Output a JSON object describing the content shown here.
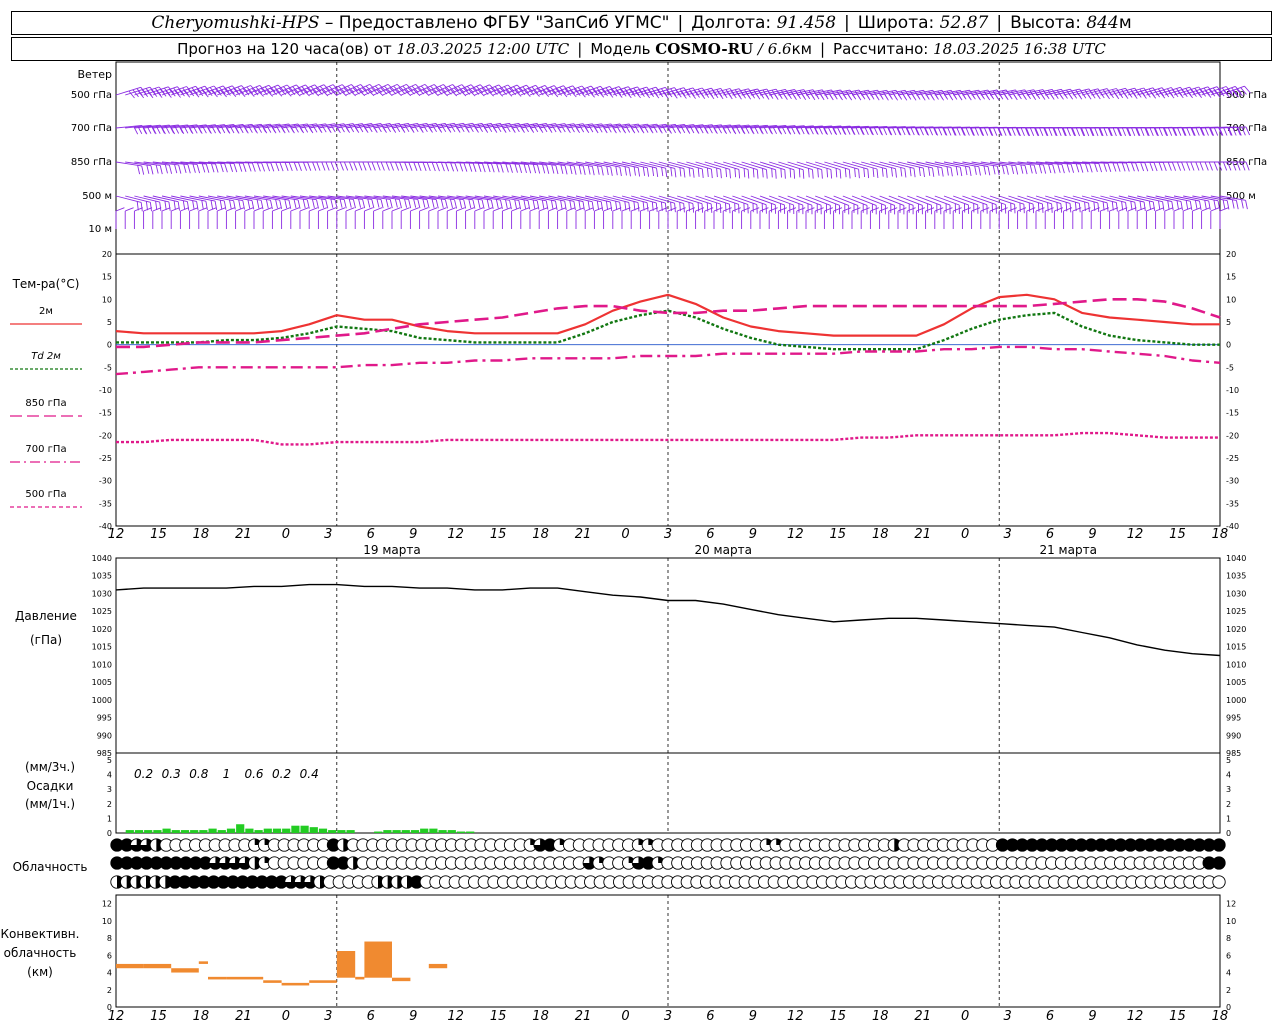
{
  "header": {
    "station": "Cheryomushki-HPS",
    "provider": "– Предоставлено ФГБУ \"ЗапСиб УГМС\"",
    "lon_label": "Долгота:",
    "lon_value": "91.458",
    "lat_label": "Широта:",
    "lat_value": "52.87",
    "alt_label": "Высота:",
    "alt_value": "844",
    "alt_unit": "м",
    "forecast_label": "Прогноз на 120 часа(ов) от",
    "forecast_start": "18.03.2025 12:00 UTC",
    "model_label": "Модель",
    "model_name": "COSMO-RU",
    "model_res": "/ 6.6",
    "model_res_unit": "км",
    "computed_label": "Рассчитано:",
    "computed_time": "18.03.2025 16:38 UTC"
  },
  "time_axis": {
    "ticks": [
      "12",
      "15",
      "18",
      "21",
      "0",
      "3",
      "6",
      "9",
      "12",
      "15",
      "18",
      "21",
      "0",
      "3",
      "6",
      "9",
      "12",
      "15",
      "18",
      "21",
      "0",
      "3",
      "6",
      "9",
      "12",
      "15",
      "18"
    ],
    "date_labels": [
      "19 марта",
      "20 марта",
      "21 марта"
    ]
  },
  "wind": {
    "title": "Ветер",
    "levels": [
      "500 гПа",
      "700 гПа",
      "850 гПа",
      "500 м",
      "10 м"
    ],
    "color": "#8a2be2"
  },
  "colors": {
    "t2m": "#ee3333",
    "td2m": "#117711",
    "t850": "#e0198a",
    "t700": "#e0198a",
    "t500": "#e0198a",
    "pressure": "#000000",
    "precip": "#22cc22",
    "conv": "#f08a30",
    "zero_line": "#2255cc"
  },
  "chart_data": [
    {
      "type": "line",
      "title": "Тем-ра(°C)",
      "ylim": [
        -40,
        20
      ],
      "yticks": [
        20,
        15,
        10,
        5,
        0,
        -5,
        -10,
        -15,
        -20,
        -25,
        -30,
        -35,
        -40
      ],
      "x_hours": [
        0,
        3,
        6,
        9,
        12,
        15,
        18,
        21,
        24,
        27,
        30,
        33,
        36,
        39,
        42,
        45,
        48,
        51,
        54,
        57,
        60,
        63,
        66,
        69,
        72,
        75,
        78,
        81,
        84,
        87,
        90,
        93,
        96,
        99,
        102,
        105,
        108,
        111,
        114,
        117,
        120
      ],
      "series": [
        {
          "name": "2м",
          "values": [
            3,
            2.5,
            2.5,
            2.5,
            2.5,
            2.5,
            3,
            4.5,
            6.5,
            5.5,
            5.5,
            4,
            3,
            2.5,
            2.5,
            2.5,
            2.5,
            4.5,
            7.5,
            9.5,
            11,
            9,
            6,
            4,
            3,
            2.5,
            2,
            2,
            2,
            2,
            4.5,
            8,
            10.5,
            11,
            10,
            7,
            6,
            5.5,
            5,
            4.5,
            4.5
          ]
        },
        {
          "name": "Td 2м",
          "values": [
            0.5,
            0.5,
            0.5,
            0.5,
            1,
            1,
            1.5,
            2.5,
            4,
            3.5,
            3,
            1.5,
            1,
            0.5,
            0.5,
            0.5,
            0.5,
            2.5,
            5,
            6.5,
            7.5,
            6,
            3.5,
            1.5,
            0,
            -0.5,
            -1,
            -1,
            -1,
            -1,
            1,
            3.5,
            5.5,
            6.5,
            7,
            4,
            2,
            1,
            0.5,
            0,
            0
          ]
        },
        {
          "name": "850 гПа",
          "values": [
            -0.5,
            -0.5,
            0,
            0.5,
            0.5,
            0.5,
            1,
            1.5,
            2,
            2.5,
            3.5,
            4.5,
            5,
            5.5,
            6,
            7,
            8,
            8.5,
            8.5,
            7.5,
            7,
            7,
            7.5,
            7.5,
            8,
            8.5,
            8.5,
            8.5,
            8.5,
            8.5,
            8.5,
            8.5,
            8.5,
            8.5,
            9,
            9.5,
            10,
            10,
            9.5,
            8,
            6
          ]
        },
        {
          "name": "700 гПа",
          "values": [
            -6.5,
            -6,
            -5.5,
            -5,
            -5,
            -5,
            -5,
            -5,
            -5,
            -4.5,
            -4.5,
            -4,
            -4,
            -3.5,
            -3.5,
            -3,
            -3,
            -3,
            -3,
            -2.5,
            -2.5,
            -2.5,
            -2,
            -2,
            -2,
            -2,
            -2,
            -1.5,
            -1.5,
            -1.5,
            -1,
            -1,
            -0.5,
            -0.5,
            -1,
            -1,
            -1.5,
            -2,
            -2.5,
            -3.5,
            -4
          ]
        },
        {
          "name": "500 гПа",
          "values": [
            -21.5,
            -21.5,
            -21,
            -21,
            -21,
            -21,
            -22,
            -22,
            -21.5,
            -21.5,
            -21.5,
            -21.5,
            -21,
            -21,
            -21,
            -21,
            -21,
            -21,
            -21,
            -21,
            -21,
            -21,
            -21,
            -21,
            -21,
            -21,
            -21,
            -20.5,
            -20.5,
            -20,
            -20,
            -20,
            -20,
            -20,
            -20,
            -19.5,
            -19.5,
            -20,
            -20.5,
            -20.5,
            -20.5
          ]
        }
      ]
    },
    {
      "type": "line",
      "title": "Давление",
      "ylabel": "(гПа)",
      "ylim": [
        985,
        1040
      ],
      "yticks": [
        1040,
        1035,
        1030,
        1025,
        1020,
        1015,
        1010,
        1005,
        1000,
        995,
        990,
        985
      ],
      "x_hours": [
        0,
        3,
        6,
        9,
        12,
        15,
        18,
        21,
        24,
        27,
        30,
        33,
        36,
        39,
        42,
        45,
        48,
        51,
        54,
        57,
        60,
        63,
        66,
        69,
        72,
        75,
        78,
        81,
        84,
        87,
        90,
        93,
        96,
        99,
        102,
        105,
        108,
        111,
        114,
        117,
        120
      ],
      "series": [
        {
          "name": "",
          "values": [
            1031,
            1031.5,
            1031.5,
            1031.5,
            1031.5,
            1032,
            1032,
            1032.5,
            1032.5,
            1032,
            1032,
            1031.5,
            1031.5,
            1031,
            1031,
            1031.5,
            1031.5,
            1030.5,
            1029.5,
            1029,
            1028,
            1028,
            1027,
            1025.5,
            1024,
            1023,
            1022,
            1022.5,
            1023,
            1023,
            1022.5,
            1022,
            1021.5,
            1021,
            1020.5,
            1019,
            1017.5,
            1015.5,
            1014,
            1013,
            1012.5
          ]
        }
      ]
    },
    {
      "type": "bar",
      "title": "Осадки",
      "ylabel": "(мм/3ч.) (мм/1ч.)",
      "ylim": [
        0,
        5
      ],
      "yticks": [
        5,
        4,
        3,
        2,
        1,
        0
      ],
      "x_hours": [
        1,
        2,
        3,
        4,
        5,
        6,
        7,
        8,
        9,
        10,
        11,
        12,
        13,
        14,
        15,
        16,
        17,
        18,
        19,
        20,
        21,
        22,
        23,
        24,
        25,
        26,
        27,
        28,
        29,
        30,
        31,
        32,
        33,
        34,
        35,
        36,
        37,
        38,
        39,
        40,
        41,
        42
      ],
      "values": [
        0,
        0.2,
        0.2,
        0.2,
        0.2,
        0.3,
        0.2,
        0.2,
        0.2,
        0.2,
        0.3,
        0.2,
        0.3,
        0.6,
        0.3,
        0.2,
        0.3,
        0.3,
        0.3,
        0.5,
        0.5,
        0.4,
        0.3,
        0.2,
        0.2,
        0.2,
        0,
        0,
        0.1,
        0.2,
        0.2,
        0.2,
        0.2,
        0.3,
        0.3,
        0.2,
        0.2,
        0.1,
        0.1,
        0,
        0,
        0
      ],
      "labels": [
        "0.2",
        "0.3",
        "0.8",
        "1",
        "0.6",
        "0.2",
        "0.4"
      ],
      "label_hours": [
        4.5,
        7.5,
        10.5,
        13.5,
        16.5,
        19.5,
        22.5
      ]
    },
    {
      "type": "bar",
      "title": "Конвективн. облачность",
      "ylabel": "(км)",
      "ylim": [
        0,
        13
      ],
      "yticks": [
        12,
        10,
        8,
        6,
        4,
        2,
        0
      ],
      "bars": [
        {
          "from": 0,
          "to": 3,
          "base": 4.5,
          "top": 5.0
        },
        {
          "from": 3,
          "to": 6,
          "base": 4.5,
          "top": 5.0
        },
        {
          "from": 6,
          "to": 9,
          "base": 4.0,
          "top": 4.5
        },
        {
          "from": 9,
          "to": 10,
          "base": 5.0,
          "top": 5.3
        },
        {
          "from": 10,
          "to": 12,
          "base": 3.2,
          "top": 3.5
        },
        {
          "from": 12,
          "to": 16,
          "base": 3.2,
          "top": 3.5
        },
        {
          "from": 16,
          "to": 18,
          "base": 2.8,
          "top": 3.1
        },
        {
          "from": 18,
          "to": 21,
          "base": 2.5,
          "top": 2.8
        },
        {
          "from": 21,
          "to": 24,
          "base": 2.8,
          "top": 3.1
        },
        {
          "from": 24,
          "to": 26,
          "base": 3.4,
          "top": 6.5
        },
        {
          "from": 26,
          "to": 27,
          "base": 3.2,
          "top": 3.5
        },
        {
          "from": 27,
          "to": 30,
          "base": 3.4,
          "top": 7.6
        },
        {
          "from": 30,
          "to": 32,
          "base": 3.0,
          "top": 3.4
        },
        {
          "from": 34,
          "to": 36,
          "base": 4.5,
          "top": 5.0
        }
      ]
    }
  ],
  "clouds": {
    "title": "Облачность",
    "rows": [
      "88664000000000220000008400000000000000000026820000000220000000000022000000000004000000000088888888888888888888888",
      "88888888886666420000008840000000000000000000000062002682000000000000000000000000000000000000000000000000000000088",
      "4444448888888888886664000004444800000000000000000000000000000000000000000000000000000000000000000000000000000000000"
    ]
  }
}
